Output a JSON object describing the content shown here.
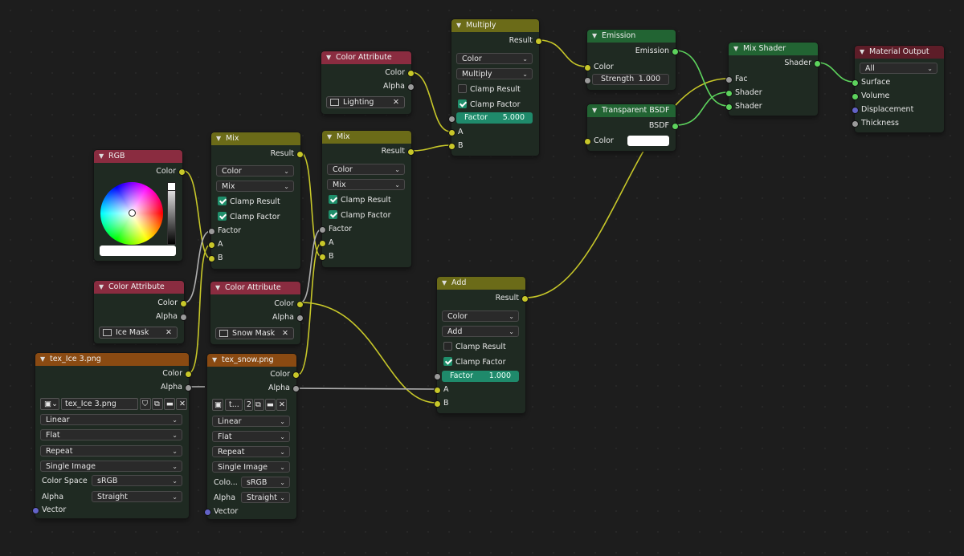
{
  "nodes": {
    "rgb": {
      "title": "RGB",
      "out_color": "Color"
    },
    "ca_lighting": {
      "title": "Color Attribute",
      "out_color": "Color",
      "out_alpha": "Alpha",
      "attr": "Lighting"
    },
    "ca_ice": {
      "title": "Color Attribute",
      "out_color": "Color",
      "out_alpha": "Alpha",
      "attr": "Ice Mask"
    },
    "ca_snow": {
      "title": "Color Attribute",
      "out_color": "Color",
      "out_alpha": "Alpha",
      "attr": "Snow Mask"
    },
    "mix1": {
      "title": "Mix",
      "result": "Result",
      "dtype": "Color",
      "mode": "Mix",
      "clamp_result": "Clamp Result",
      "clamp_factor": "Clamp Factor",
      "factor": "Factor",
      "a": "A",
      "b": "B"
    },
    "mix2": {
      "title": "Mix",
      "result": "Result",
      "dtype": "Color",
      "mode": "Mix",
      "clamp_result": "Clamp Result",
      "clamp_factor": "Clamp Factor",
      "factor": "Factor",
      "a": "A",
      "b": "B"
    },
    "multiply": {
      "title": "Multiply",
      "result": "Result",
      "dtype": "Color",
      "mode": "Multiply",
      "clamp_result": "Clamp Result",
      "clamp_factor": "Clamp Factor",
      "factor_label": "Factor",
      "factor_value": "5.000",
      "a": "A",
      "b": "B"
    },
    "add": {
      "title": "Add",
      "result": "Result",
      "dtype": "Color",
      "mode": "Add",
      "clamp_result": "Clamp Result",
      "clamp_factor": "Clamp Factor",
      "factor_label": "Factor",
      "factor_value": "1.000",
      "a": "A",
      "b": "B"
    },
    "emission": {
      "title": "Emission",
      "out": "Emission",
      "color": "Color",
      "strength_label": "Strength",
      "strength_value": "1.000"
    },
    "transparent": {
      "title": "Transparent BSDF",
      "out": "BSDF",
      "color": "Color"
    },
    "mixshader": {
      "title": "Mix Shader",
      "out": "Shader",
      "fac": "Fac",
      "shader1": "Shader",
      "shader2": "Shader"
    },
    "output": {
      "title": "Material Output",
      "target": "All",
      "surface": "Surface",
      "volume": "Volume",
      "displacement": "Displacement",
      "thickness": "Thickness"
    },
    "tex_ice": {
      "title": "tex_Ice 3.png",
      "out_color": "Color",
      "out_alpha": "Alpha",
      "image": "tex_Ice 3.png",
      "interp": "Linear",
      "proj": "Flat",
      "ext": "Repeat",
      "source": "Single Image",
      "cs_label": "Color Space",
      "cs_value": "sRGB",
      "alpha_label": "Alpha",
      "alpha_value": "Straight",
      "vector": "Vector"
    },
    "tex_snow": {
      "title": "tex_snow.png",
      "out_color": "Color",
      "out_alpha": "Alpha",
      "image": "t...",
      "users": "2",
      "interp": "Linear",
      "proj": "Flat",
      "ext": "Repeat",
      "source": "Single Image",
      "cs_label": "Colo...",
      "cs_value": "sRGB",
      "alpha_label": "Alpha",
      "alpha_value": "Straight",
      "vector": "Vector"
    }
  },
  "colors": {
    "socket_color": "#c7c729",
    "socket_float": "#9a9a9a",
    "socket_shader": "#5dd35d",
    "socket_vector": "#6363c7",
    "wire_color": "#c7c729",
    "wire_shader": "#5dd35d",
    "wire_float": "#b0b0b0",
    "header_mix": "#6b6b18",
    "header_attribute": "#8a2c40",
    "header_texture": "#8a4a12",
    "header_shader": "#226433",
    "header_output": "#5d1d28",
    "check_on": "#1f8f6b",
    "factor_field": "#1f8a6b"
  }
}
